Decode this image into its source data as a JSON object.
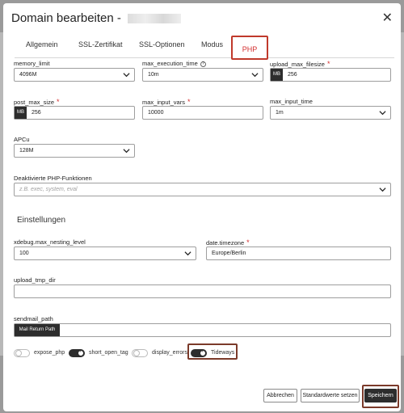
{
  "dialog": {
    "title": "Domain bearbeiten -",
    "close_symbol": "✕"
  },
  "tabs": [
    {
      "label": "Allgemein"
    },
    {
      "label": "SSL-Zertifikat"
    },
    {
      "label": "SSL-Optionen"
    },
    {
      "label": "Modus"
    },
    {
      "label": "PHP",
      "active": true
    }
  ],
  "fields": {
    "memory_limit": {
      "label": "memory_limit",
      "value": "4096M"
    },
    "max_execution_time": {
      "label": "max_execution_time",
      "value": "10m"
    },
    "upload_max_filesize": {
      "label": "upload_max_filesize",
      "unit": "MB",
      "value": "256"
    },
    "post_max_size": {
      "label": "post_max_size",
      "unit": "MB",
      "value": "256"
    },
    "max_input_vars": {
      "label": "max_input_vars",
      "value": "10000"
    },
    "max_input_time": {
      "label": "max_input_time",
      "value": "1m"
    },
    "apcu": {
      "label": "APCu",
      "value": "128M"
    },
    "disabled_functions": {
      "label": "Deaktivierte PHP-Funktionen",
      "placeholder": "z.B. exec, system, eval"
    },
    "xdebug": {
      "label": "xdebug.max_nesting_level",
      "value": "100"
    },
    "timezone": {
      "label": "date.timezone",
      "value": "Europe/Berlin"
    },
    "upload_tmp_dir": {
      "label": "upload_tmp_dir",
      "value": ""
    },
    "sendmail_path": {
      "label": "sendmail_path",
      "addon": "Mail Return Path",
      "value": ""
    }
  },
  "section_title": "Einstellungen",
  "required_marker": "*",
  "toggles": [
    {
      "label": "expose_php",
      "on": false
    },
    {
      "label": "short_open_tag",
      "on": true
    },
    {
      "label": "display_errors",
      "on": false
    },
    {
      "label": "Tideways",
      "on": true
    }
  ],
  "buttons": {
    "cancel": "Abbrechen",
    "defaults": "Standardwerte setzen",
    "save": "Speichern"
  },
  "colors": {
    "accent": "#d32f2f",
    "dark": "#2d2d2d",
    "highlight_frame": "#7b3a2a"
  },
  "icons": {
    "dropdown": "chevron-down-icon",
    "info": "info-icon",
    "close": "close-icon"
  }
}
